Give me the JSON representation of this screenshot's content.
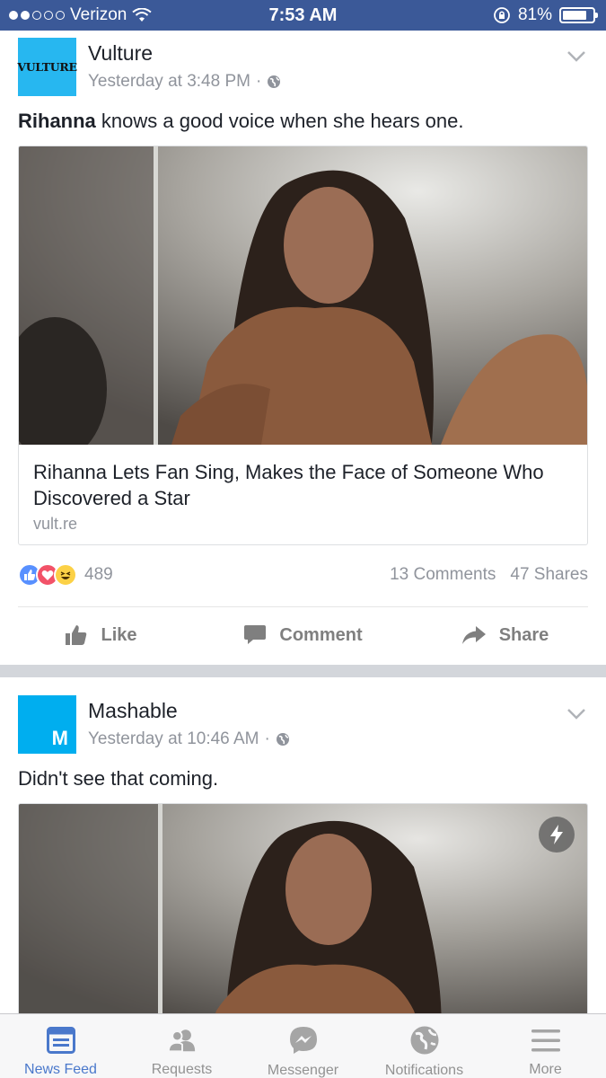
{
  "status_bar": {
    "carrier": "Verizon",
    "time": "7:53 AM",
    "battery": "81%",
    "battery_level": 0.81,
    "signal_bars": 2
  },
  "posts": [
    {
      "page_name": "Vulture",
      "avatar_text": "VULTURE",
      "avatar_color": "#27b7f0",
      "timestamp": "Yesterday at 3:48 PM",
      "meta_sep": "·",
      "text_bold": "Rihanna",
      "text_rest": " knows a good voice when she hears one.",
      "link_title": "Rihanna Lets Fan Sing, Makes the Face of Someone Who Discovered a Star",
      "link_domain": "vult.re",
      "reaction_count": "489",
      "comments": "13 Comments",
      "shares": "47 Shares",
      "actions": {
        "like": "Like",
        "comment": "Comment",
        "share": "Share"
      }
    },
    {
      "page_name": "Mashable",
      "avatar_text": "M",
      "avatar_color": "#00aeef",
      "timestamp": "Yesterday at 10:46 AM",
      "meta_sep": "·",
      "text": "Didn't see that coming."
    }
  ],
  "tab_bar": [
    {
      "label": "News Feed",
      "icon": "news-feed-icon",
      "active": true
    },
    {
      "label": "Requests",
      "icon": "friend-requests-icon",
      "active": false
    },
    {
      "label": "Messenger",
      "icon": "messenger-icon",
      "active": false
    },
    {
      "label": "Notifications",
      "icon": "globe-icon",
      "active": false
    },
    {
      "label": "More",
      "icon": "menu-icon",
      "active": false
    }
  ],
  "colors": {
    "brand": "#3b5998",
    "active_tab": "#4a78cb",
    "muted": "#90949c"
  }
}
